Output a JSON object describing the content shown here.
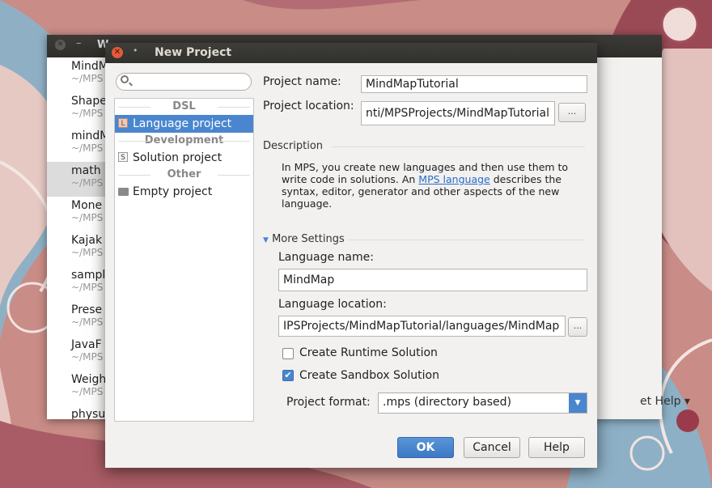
{
  "background_window": {
    "title": "W",
    "recent_projects": [
      {
        "name": "MindM",
        "path": "~/MPS"
      },
      {
        "name": "Shape",
        "path": "~/MPS"
      },
      {
        "name": "mindM",
        "path": "~/MPS"
      },
      {
        "name": "math",
        "path": "~/MPS"
      },
      {
        "name": "Mone",
        "path": "~/MPS"
      },
      {
        "name": "Kajak",
        "path": "~/MPS"
      },
      {
        "name": "sampl",
        "path": "~/MPS"
      },
      {
        "name": "Prese",
        "path": "~/MPS"
      },
      {
        "name": "JavaF",
        "path": "~/MPS"
      },
      {
        "name": "Weigh",
        "path": "~/MPS"
      },
      {
        "name": "physu",
        "path": ""
      }
    ],
    "get_help": "et Help ▾"
  },
  "dialog": {
    "title": "New Project",
    "search_placeholder": "",
    "tree": {
      "group_dsl": "DSL",
      "language_project": "Language project",
      "group_development": "Development",
      "solution_project": "Solution project",
      "group_other": "Other",
      "empty_project": "Empty project"
    },
    "project_name_label": "Project name:",
    "project_name_value": "MindMapTutorial",
    "project_location_label": "Project location:",
    "project_location_value": "nti/MPSProjects/MindMapTutorial",
    "browse_label": "...",
    "description_label": "Description",
    "description": {
      "part1": "In MPS, you create new languages and then use them to write code in solutions. An ",
      "link": "MPS language",
      "part2": " describes the syntax, editor, generator and other aspects of the new language."
    },
    "more_settings_label": "More Settings",
    "language_name_label": "Language name:",
    "language_name_value": "MindMap",
    "language_location_label": "Language location:",
    "language_location_value": "IPSProjects/MindMapTutorial/languages/MindMap",
    "create_runtime_label": "Create Runtime Solution",
    "create_runtime_checked": false,
    "create_sandbox_label": "Create Sandbox Solution",
    "create_sandbox_checked": true,
    "project_format_label": "Project format:",
    "project_format_value": ".mps (directory based)",
    "ok_label": "OK",
    "cancel_label": "Cancel",
    "help_label": "Help"
  },
  "colors": {
    "accent": "#4a86cf",
    "titlebar": "#3c3b37",
    "close_button": "#e35a3a"
  }
}
